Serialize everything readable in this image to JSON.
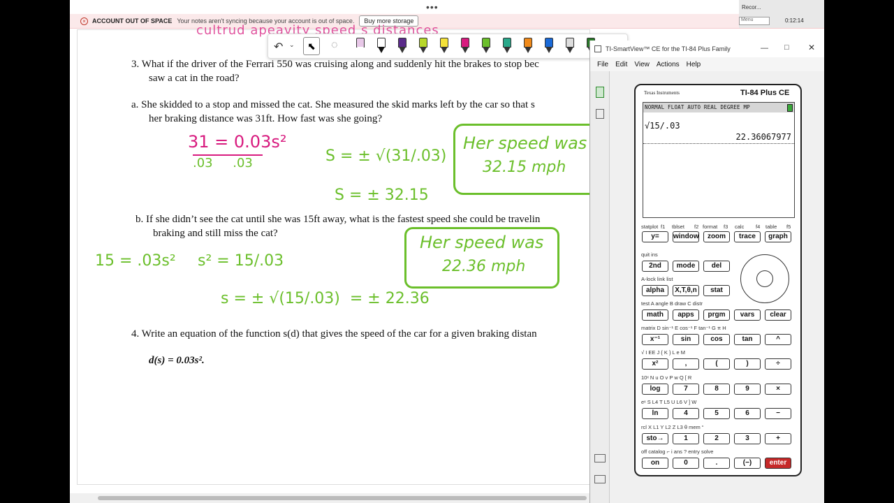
{
  "banner": {
    "title": "ACCOUNT OUT OF SPACE",
    "message": "Your notes aren't syncing because your account is out of space.",
    "button": "Buy more storage"
  },
  "topdots": "•••",
  "recorder": {
    "label": "Recor...",
    "time": "0:12:14",
    "menu": "Menu"
  },
  "doc": {
    "q3": "3.   What if the driver of the Ferrari 550 was cruising along and suddenly hit the brakes to stop bec",
    "q3b": "saw a cat in the road?",
    "qa1": "a.    She skidded to a stop and missed the cat.  She measured the skid marks left by the car so that s",
    "qa2": "her braking distance was 31ft.  How fast was she going?",
    "qb1": "b.    If she didn’t see the cat until she was 15ft away, what is the fastest speed she could be travelin",
    "qb2": "braking and still miss the cat?",
    "q4": "4.   Write an equation of the function s(d) that gives the speed of the car for a given braking distan",
    "eq": "d(s) = 0.03s².",
    "pink_top": "cultrud apeavity speed s distances",
    "hw": {
      "a_eq1": "31 = 0.03s²",
      "a_den": ".03     .03",
      "a_eq2": "S = ± √(31/.03)",
      "a_eq3": "S = ± 32.15",
      "a_box": "Her speed was",
      "a_box2": "32.15 mph",
      "b_eq1": "15 = .03s²",
      "b_eq2": "s² = 15/.03",
      "b_eq3": "s = ± √(15/.03)  = ± 22.36",
      "b_box": "Her speed was",
      "b_box2": "22.36 mph"
    }
  },
  "calc": {
    "title": "TI-SmartView™ CE for the TI-84 Plus Family",
    "menu": [
      "File",
      "Edit",
      "View",
      "Actions",
      "Help"
    ],
    "brand": "Texas Instruments",
    "model": "TI-84 Plus CE",
    "status": "NORMAL FLOAT AUTO REAL DEGREE MP",
    "input": "√15/.03",
    "output": "22.36067977",
    "keys_row1_labels": [
      "statplot",
      "f1",
      "tblset",
      "f2",
      "format",
      "f3",
      "calc",
      "f4",
      "table",
      "f5"
    ],
    "keys_row1": [
      "y=",
      "window",
      "zoom",
      "trace",
      "graph"
    ],
    "keys": [
      [
        "2nd",
        "mode",
        "del"
      ],
      [
        "alpha",
        "X,T,θ,n",
        "stat"
      ],
      [
        "math",
        "apps",
        "prgm",
        "vars",
        "clear"
      ],
      [
        "x⁻¹",
        "sin",
        "cos",
        "tan",
        "^"
      ],
      [
        "x²",
        ",",
        "(",
        ")",
        "÷"
      ],
      [
        "log",
        "7",
        "8",
        "9",
        "×"
      ],
      [
        "ln",
        "4",
        "5",
        "6",
        "−"
      ],
      [
        "sto→",
        "1",
        "2",
        "3",
        "+"
      ],
      [
        "on",
        "0",
        ".",
        "(−)",
        "enter"
      ]
    ],
    "sublabels": [
      "quit   ins",
      "A-lock   link   list",
      "test  A  angle  B  draw  C  distr",
      "matrix D  sin⁻¹ E  cos⁻¹ F  tan⁻¹ G  π  H",
      "√  I  EE  J  {  K  }  L  e  M",
      "10ˣ  N  u  O  v  P  w  Q  [  R",
      "eˣ  S  L4  T  L5  U  L6  V  ]  W",
      "rcl  X  L1  Y  L2  Z  L3  θ  mem  “",
      "off   catalog  ⌐   i   ans   ?  entry solve"
    ]
  }
}
